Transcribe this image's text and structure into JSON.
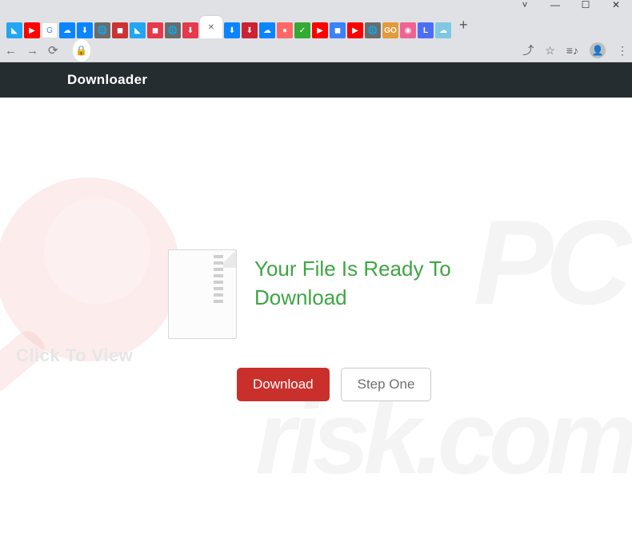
{
  "browser": {
    "window_controls": {
      "chevron": "˅",
      "minimize": "—",
      "maximize": "☐",
      "close": "✕"
    },
    "new_tab": "+",
    "nav": {
      "back": "←",
      "forward": "→",
      "reload": "⟳"
    },
    "omnibox_icons": {
      "lock": "🔒",
      "share": "⤴",
      "star": "☆",
      "reading": "≡♪",
      "dots": "⋮"
    }
  },
  "page": {
    "header_title": "Downloader",
    "headline": "Your File Is Ready To Download",
    "buttons": {
      "primary": "Download",
      "secondary": "Step One"
    },
    "watermark_text": "Click To View"
  }
}
